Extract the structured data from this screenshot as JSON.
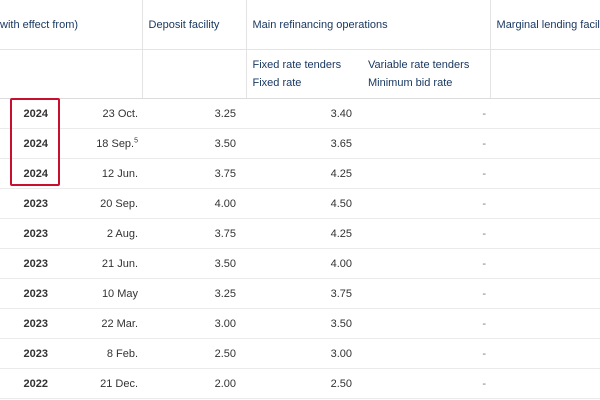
{
  "header": {
    "col_date_group": "with effect from)",
    "col_deposit": "Deposit facility",
    "col_mro": "Main refinancing operations",
    "col_marginal": "Marginal lending facilit",
    "fixed_line1": "Fixed rate tenders",
    "fixed_line2": "Fixed rate",
    "variable_line1": "Variable rate tenders",
    "variable_line2": "Minimum bid rate"
  },
  "rows": [
    {
      "year": "2024",
      "date": "23 Oct.",
      "date_sup": "",
      "deposit": "3.25",
      "fixed": "3.40",
      "variable": "-"
    },
    {
      "year": "2024",
      "date": "18 Sep.",
      "date_sup": "5",
      "deposit": "3.50",
      "fixed": "3.65",
      "variable": "-"
    },
    {
      "year": "2024",
      "date": "12 Jun.",
      "date_sup": "",
      "deposit": "3.75",
      "fixed": "4.25",
      "variable": "-"
    },
    {
      "year": "2023",
      "date": "20 Sep.",
      "date_sup": "",
      "deposit": "4.00",
      "fixed": "4.50",
      "variable": "-"
    },
    {
      "year": "2023",
      "date": "2 Aug.",
      "date_sup": "",
      "deposit": "3.75",
      "fixed": "4.25",
      "variable": "-"
    },
    {
      "year": "2023",
      "date": "21 Jun.",
      "date_sup": "",
      "deposit": "3.50",
      "fixed": "4.00",
      "variable": "-"
    },
    {
      "year": "2023",
      "date": "10 May",
      "date_sup": "",
      "deposit": "3.25",
      "fixed": "3.75",
      "variable": "-"
    },
    {
      "year": "2023",
      "date": "22 Mar.",
      "date_sup": "",
      "deposit": "3.00",
      "fixed": "3.50",
      "variable": "-"
    },
    {
      "year": "2023",
      "date": "8 Feb.",
      "date_sup": "",
      "deposit": "2.50",
      "fixed": "3.00",
      "variable": "-"
    },
    {
      "year": "2022",
      "date": "21 Dec.",
      "date_sup": "",
      "deposit": "2.00",
      "fixed": "2.50",
      "variable": "-"
    }
  ],
  "colors": {
    "header_text": "#17365f",
    "highlight_border": "#c8102e",
    "body_text": "#333333"
  }
}
